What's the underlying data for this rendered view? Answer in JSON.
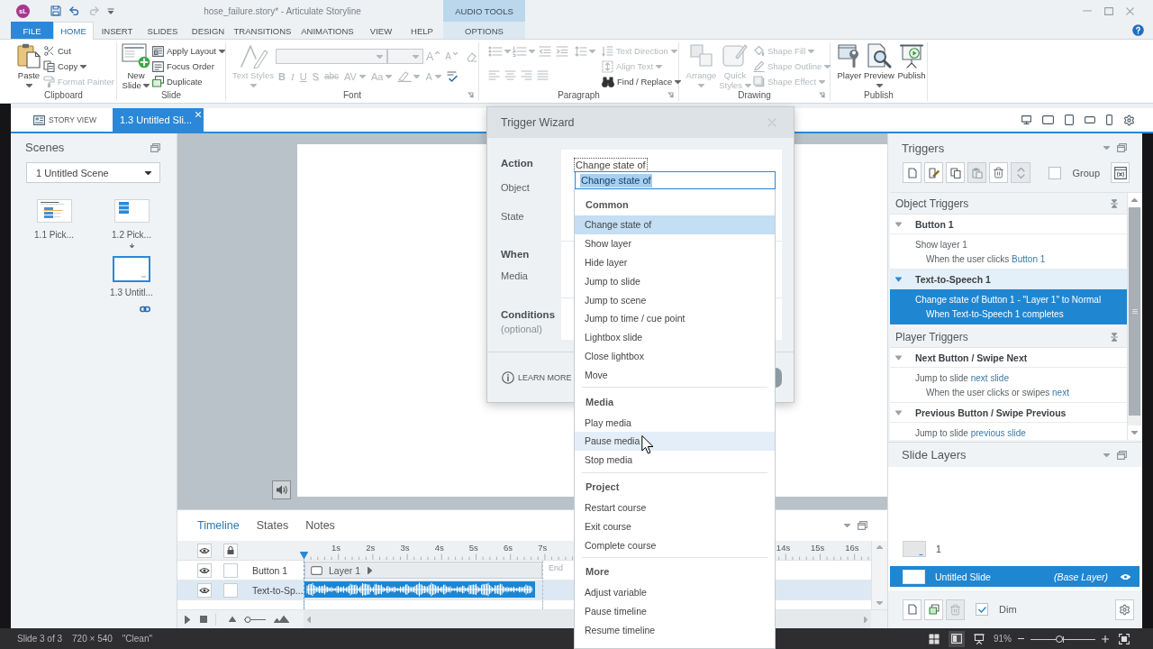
{
  "title_bar": {
    "logo": "sL",
    "title": "hose_failure.story* - Articulate Storyline",
    "context_header": "AUDIO TOOLS"
  },
  "ribbon_tabs": [
    {
      "label": "FILE",
      "kind": "file",
      "selected": false
    },
    {
      "label": "HOME",
      "kind": "tab",
      "selected": true
    },
    {
      "label": "INSERT",
      "kind": "tab",
      "selected": false
    },
    {
      "label": "SLIDES",
      "kind": "tab",
      "selected": false
    },
    {
      "label": "DESIGN",
      "kind": "tab",
      "selected": false
    },
    {
      "label": "TRANSITIONS",
      "kind": "tab",
      "selected": false
    },
    {
      "label": "ANIMATIONS",
      "kind": "tab",
      "selected": false
    },
    {
      "label": "VIEW",
      "kind": "tab",
      "selected": false
    },
    {
      "label": "HELP",
      "kind": "tab",
      "selected": false
    },
    {
      "label": "OPTIONS",
      "kind": "context",
      "selected": false
    }
  ],
  "ribbon_groups": [
    {
      "label": "Clipboard",
      "kind": "basic",
      "large": [
        {
          "label": "Paste",
          "dropdown": true,
          "disabled": false
        }
      ],
      "small": [
        {
          "label": "Cut",
          "disabled": false
        },
        {
          "label": "Copy",
          "dropdown": true,
          "disabled": false
        },
        {
          "label": "Format Painter",
          "disabled": true
        }
      ]
    },
    {
      "label": "Slide",
      "kind": "basic",
      "large": [
        {
          "label": "New Slide",
          "dropdown": true,
          "disabled": false
        }
      ],
      "small": [
        {
          "label": "Apply Layout",
          "dropdown": true,
          "disabled": false
        },
        {
          "label": "Focus Order",
          "disabled": false
        },
        {
          "label": "Duplicate",
          "disabled": false
        }
      ]
    },
    {
      "label": "Font",
      "kind": "font",
      "launcher": true,
      "tools_disabled": true,
      "large": [
        {
          "label": "Text Styles",
          "dropdown": true,
          "disabled": true
        }
      ],
      "size_glyphs": [
        {
          "label": "A",
          "kind": "grow"
        },
        {
          "label": "A",
          "kind": "shrink"
        }
      ],
      "glyphs": [
        {
          "label": "B",
          "kind": "bold"
        },
        {
          "label": "I",
          "kind": "italic"
        },
        {
          "label": "U",
          "kind": "underline"
        },
        {
          "label": "S",
          "kind": "shadow"
        },
        {
          "label": "abc",
          "kind": "strike"
        },
        {
          "label": "AV",
          "kind": "spacing",
          "dropdown": true
        },
        {
          "label": "Aa",
          "kind": "case",
          "dropdown": true
        },
        {
          "label": "A",
          "kind": "color",
          "dropdown": true
        }
      ]
    },
    {
      "label": "Paragraph",
      "kind": "paragraph",
      "launcher": true,
      "tools_disabled": true,
      "small": [
        {
          "label": "Text Direction",
          "dropdown": true,
          "disabled": true
        },
        {
          "label": "Align Text",
          "dropdown": true,
          "disabled": true
        },
        {
          "label": "Find / Replace",
          "dropdown": true,
          "disabled": false
        }
      ]
    },
    {
      "label": "Drawing",
      "kind": "basic",
      "launcher": true,
      "large": [
        {
          "label": "Arrange",
          "dropdown": true,
          "disabled": true
        },
        {
          "label": "Quick Styles",
          "dropdown": true,
          "disabled": true
        }
      ],
      "small": [
        {
          "label": "Shape Fill",
          "dropdown": true,
          "disabled": true
        },
        {
          "label": "Shape Outline",
          "dropdown": true,
          "disabled": true
        },
        {
          "label": "Shape Effect",
          "dropdown": true,
          "disabled": true
        }
      ]
    },
    {
      "label": "Publish",
      "kind": "basic",
      "large": [
        {
          "label": "Player",
          "disabled": false
        },
        {
          "label": "Preview",
          "dropdown": true,
          "disabled": false
        },
        {
          "label": "Publish",
          "disabled": false
        }
      ]
    }
  ],
  "view_tabs": [
    {
      "label": "STORY VIEW",
      "kind": "story",
      "selected": false
    },
    {
      "label": "1.3 Untitled Sli...",
      "kind": "slide",
      "selected": true
    }
  ],
  "scenes": {
    "title": "Scenes",
    "scene": "1 Untitled Scene",
    "slides": [
      {
        "label": "1.1 Pick...",
        "kind": "table",
        "selected": false
      },
      {
        "label": "1.2 Pick...",
        "kind": "list",
        "selected": false
      },
      {
        "label": "1.3 Untitl...",
        "kind": "blank",
        "selected": true,
        "incoming": true,
        "linked": true
      }
    ]
  },
  "timeline": {
    "tabs": [
      {
        "label": "Timeline",
        "selected": true
      },
      {
        "label": "States",
        "selected": false
      },
      {
        "label": "Notes",
        "selected": false
      }
    ],
    "ruler_start": [
      "1s",
      "2s",
      "3s",
      "4s",
      "5s",
      "6s",
      "7s"
    ],
    "ruler_end": [
      "14s",
      "15s",
      "16s"
    ],
    "end_label": "End",
    "rows": [
      {
        "name": "Button 1",
        "kind": "layer",
        "bar_label": "Layer 1",
        "selected": false,
        "locked": false
      },
      {
        "name": "Text-to-Sp...",
        "kind": "audio",
        "selected": true,
        "locked": false
      }
    ],
    "zoom": {
      "level": 0.15
    }
  },
  "triggers": {
    "title": "Triggers",
    "toolbar": [
      {
        "disabled": false
      },
      {
        "disabled": false
      },
      {
        "disabled": false
      },
      {
        "disabled": true
      },
      {
        "disabled": false
      },
      {
        "disabled": true
      }
    ],
    "group_label": "Group",
    "group_checked": false,
    "sections": [
      {
        "title": "Object Triggers",
        "objects": [
          {
            "name": "Button 1",
            "expanded": true,
            "selected": false,
            "triggers": [
              {
                "selected": false,
                "action": [
                  {
                    "text": "Show layer 1"
                  }
                ],
                "condition": [
                  {
                    "text": "When the user clicks"
                  },
                  {
                    "text": "Button 1",
                    "link": true
                  }
                ]
              }
            ]
          },
          {
            "name": "Text-to-Speech 1",
            "expanded": true,
            "selected": true,
            "triggers": [
              {
                "selected": true,
                "action": [
                  {
                    "text": "Change state of Button 1 - \"Layer 1\" to Normal"
                  }
                ],
                "condition": [
                  {
                    "text": "When Text-to-Speech 1 completes"
                  }
                ]
              }
            ]
          }
        ]
      },
      {
        "title": "Player Triggers",
        "objects": [
          {
            "name": "Next Button / Swipe Next",
            "expanded": true,
            "selected": false,
            "triggers": [
              {
                "selected": false,
                "action": [
                  {
                    "text": "Jump to slide"
                  },
                  {
                    "text": "next slide",
                    "link": true
                  }
                ],
                "condition": [
                  {
                    "text": "When the user clicks or swipes"
                  },
                  {
                    "text": "next",
                    "link": true
                  }
                ]
              }
            ]
          },
          {
            "name": "Previous Button / Swipe Previous",
            "expanded": true,
            "selected": false,
            "triggers": [
              {
                "selected": false,
                "action": [
                  {
                    "text": "Jump to slide"
                  },
                  {
                    "text": "previous slide",
                    "link": true
                  }
                ]
              }
            ]
          }
        ]
      }
    ]
  },
  "slide_layers": {
    "title": "Slide Layers",
    "layers": [
      {
        "label": "1",
        "selected": false
      },
      {
        "label": "Untitled Slide",
        "note": "(Base Layer)",
        "selected": true
      }
    ],
    "toolbar": [
      {
        "disabled": false
      },
      {
        "disabled": false
      },
      {
        "disabled": true
      }
    ],
    "dim_label": "Dim",
    "dim_checked": true
  },
  "status_bar": {
    "items": [
      "Slide 3 of 3",
      "720 × 540",
      "\"Clean\""
    ],
    "view_modes": [
      {
        "selected": false
      },
      {
        "selected": true
      },
      {
        "selected": false
      }
    ],
    "zoom": {
      "reading": "91%",
      "level": 0.45
    }
  },
  "trigger_wizard": {
    "title": "Trigger Wizard",
    "action_value": "Change state of",
    "sections": [
      {
        "heading": "Action",
        "fields": [
          "Object",
          "State"
        ]
      },
      {
        "heading": "When",
        "fields": [
          "Media"
        ]
      },
      {
        "heading": "Conditions",
        "note": "(optional)"
      }
    ],
    "learn_more": "LEARN MORE"
  },
  "action_dropdown": {
    "value": "Change state of",
    "value_highlighted": true,
    "groups": [
      {
        "title": "Common",
        "items": [
          {
            "label": "Change state of",
            "selected": true,
            "hovered": false
          },
          {
            "label": "Show layer",
            "selected": false,
            "hovered": false
          },
          {
            "label": "Hide layer",
            "selected": false,
            "hovered": false
          },
          {
            "label": "Jump to slide",
            "selected": false,
            "hovered": false
          },
          {
            "label": "Jump to scene",
            "selected": false,
            "hovered": false
          },
          {
            "label": "Jump to time / cue point",
            "selected": false,
            "hovered": false
          },
          {
            "label": "Lightbox slide",
            "selected": false,
            "hovered": false
          },
          {
            "label": "Close lightbox",
            "selected": false,
            "hovered": false
          },
          {
            "label": "Move",
            "selected": false,
            "hovered": false
          }
        ]
      },
      {
        "title": "Media",
        "items": [
          {
            "label": "Play media",
            "selected": false,
            "hovered": false
          },
          {
            "label": "Pause media",
            "selected": false,
            "hovered": true
          },
          {
            "label": "Stop media",
            "selected": false,
            "hovered": false
          }
        ]
      },
      {
        "title": "Project",
        "items": [
          {
            "label": "Restart course",
            "selected": false,
            "hovered": false
          },
          {
            "label": "Exit course",
            "selected": false,
            "hovered": false
          },
          {
            "label": "Complete course",
            "selected": false,
            "hovered": false
          }
        ]
      },
      {
        "title": "More",
        "items": [
          {
            "label": "Adjust variable",
            "selected": false,
            "hovered": false
          },
          {
            "label": "Pause timeline",
            "selected": false,
            "hovered": false
          },
          {
            "label": "Resume timeline",
            "selected": false,
            "hovered": false
          }
        ]
      }
    ]
  }
}
